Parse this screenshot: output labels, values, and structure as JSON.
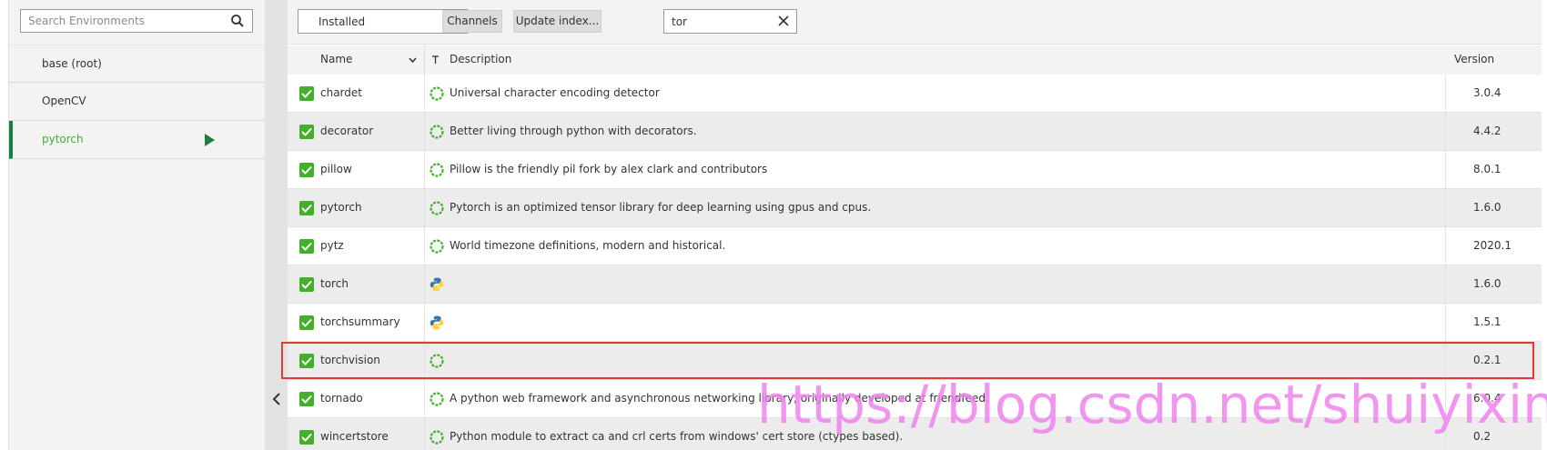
{
  "sidebar": {
    "search_placeholder": "Search Environments",
    "environments": [
      {
        "label": "base (root)",
        "active": false
      },
      {
        "label": "OpenCV",
        "active": false
      },
      {
        "label": "pytorch",
        "active": true
      }
    ]
  },
  "toolbar": {
    "filter_select": "Installed",
    "channels_label": "Channels",
    "update_label": "Update index...",
    "search_value": "tor"
  },
  "table": {
    "headers": {
      "name": "Name",
      "description": "Description",
      "version": "Version"
    },
    "rows": [
      {
        "name": "chardet",
        "description": "Universal character encoding detector",
        "version": "3.0.4",
        "icon": "conda-ring-icon"
      },
      {
        "name": "decorator",
        "description": "Better living through python with decorators.",
        "version": "4.4.2",
        "icon": "conda-ring-icon"
      },
      {
        "name": "pillow",
        "description": "Pillow is the friendly pil fork by alex clark and contributors",
        "version": "8.0.1",
        "icon": "conda-ring-icon"
      },
      {
        "name": "pytorch",
        "description": "Pytorch is an optimized tensor library for deep learning using gpus and cpus.",
        "version": "1.6.0",
        "icon": "conda-ring-icon"
      },
      {
        "name": "pytz",
        "description": "World timezone definitions, modern and historical.",
        "version": "2020.1",
        "icon": "conda-ring-icon"
      },
      {
        "name": "torch",
        "description": "",
        "version": "1.6.0",
        "icon": "python-icon"
      },
      {
        "name": "torchsummary",
        "description": "",
        "version": "1.5.1",
        "icon": "python-icon"
      },
      {
        "name": "torchvision",
        "description": "",
        "version": "0.2.1",
        "icon": "conda-ring-icon"
      },
      {
        "name": "tornado",
        "description": "A python web framework and asynchronous networking library, originally developed at friendfeed.",
        "version": "6.0.4",
        "icon": "conda-ring-icon"
      },
      {
        "name": "wincertstore",
        "description": "Python module to extract ca and crl certs from windows' cert store (ctypes based).",
        "version": "0.2",
        "icon": "conda-ring-icon"
      }
    ]
  },
  "watermark": "https://blog.csdn.net/shuiyixin",
  "colors": {
    "accent": "#43b02a",
    "active_env": "#1a7f43",
    "highlight": "#e53935",
    "watermark": "#ee82ee"
  }
}
